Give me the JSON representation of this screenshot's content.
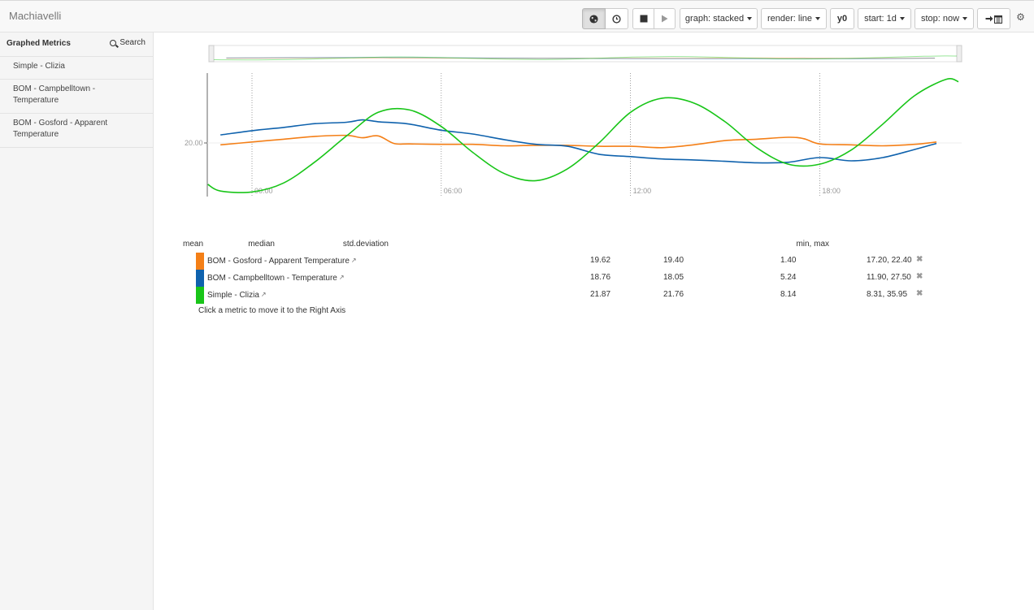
{
  "app": {
    "title": "Machiavelli"
  },
  "toolbar": {
    "live_icon": "globe-icon",
    "clock_icon": "clock-icon",
    "stop_icon": "stop-icon",
    "play_icon": "play-icon",
    "graph_label": "graph: stacked",
    "render_label": "render: line",
    "y0_label": "y0",
    "start_label": "start: 1d",
    "stop_label": "stop: now",
    "export_icon": "arrow-right-icon",
    "calendar_icon": "calendar-icon",
    "settings_icon": "gear-icon"
  },
  "sidebar": {
    "title": "Graphed Metrics",
    "search_label": "Search",
    "items": [
      {
        "label": "Simple - Clizia"
      },
      {
        "label": "BOM - Campbelltown - Temperature"
      },
      {
        "label": "BOM - Gosford - Apparent Temperature"
      }
    ]
  },
  "chart_data": {
    "type": "line",
    "y_tick_label": "20.00",
    "x_tick_labels": [
      "00:00",
      "06:00",
      "12:00",
      "18:00"
    ],
    "grid": "vertical dotted",
    "series": [
      {
        "name": "BOM - Gosford - Apparent Temperature",
        "color": "#f47f17",
        "x_hours": [
          -1.0,
          0,
          1,
          2,
          3,
          3.5,
          4,
          4.5,
          5,
          6,
          7,
          8,
          9,
          10,
          11,
          12,
          13,
          14,
          15,
          16,
          17,
          17.5,
          18,
          19,
          20,
          21,
          21.7
        ],
        "values": [
          19.6,
          20.2,
          20.8,
          21.4,
          21.6,
          21.1,
          21.5,
          19.9,
          19.8,
          19.7,
          19.7,
          19.4,
          19.5,
          19.5,
          19.3,
          19.3,
          19.0,
          19.6,
          20.5,
          20.8,
          21.2,
          20.9,
          19.8,
          19.6,
          19.4,
          19.7,
          20.2
        ]
      },
      {
        "name": "BOM - Campbelltown - Temperature",
        "color": "#0f62ad",
        "x_hours": [
          -1.0,
          0,
          1,
          2,
          3,
          3.5,
          4,
          4.5,
          5,
          6,
          7,
          8,
          9,
          10,
          11,
          12,
          13,
          14,
          15,
          16,
          17,
          18,
          19,
          20,
          21,
          21.7
        ],
        "values": [
          21.7,
          22.6,
          23.3,
          24.1,
          24.4,
          24.9,
          24.5,
          24.3,
          24.0,
          22.7,
          21.9,
          20.7,
          19.7,
          19.3,
          17.6,
          17.1,
          16.6,
          16.4,
          16.1,
          15.8,
          15.9,
          16.9,
          16.2,
          16.9,
          18.6,
          19.9
        ]
      },
      {
        "name": "Simple - Clizia",
        "color": "#18c518",
        "x_hours": [
          -1.4,
          -1,
          0,
          1,
          2,
          3,
          4,
          5,
          6,
          7,
          8,
          9,
          10,
          11,
          12,
          13,
          14,
          15,
          16,
          17,
          18,
          19,
          20,
          21,
          22,
          22.4
        ],
        "values": [
          11.2,
          9.8,
          9.6,
          11.5,
          16.0,
          21.5,
          26.5,
          27.0,
          23.5,
          18.0,
          13.5,
          12.0,
          14.5,
          20.0,
          26.5,
          29.5,
          28.5,
          24.5,
          19.0,
          15.5,
          15.5,
          18.5,
          24.0,
          30.0,
          33.5,
          33.0
        ]
      }
    ]
  },
  "legend": {
    "headers": {
      "mean": "mean",
      "median": "median",
      "std": "std.deviation",
      "minmax": "min, max"
    },
    "rows": [
      {
        "name": "BOM - Gosford - Apparent Temperature",
        "color": "#f47f17",
        "mean": "19.62",
        "median": "19.40",
        "std": "1.40",
        "minmax": "17.20, 22.40"
      },
      {
        "name": "BOM - Campbelltown - Temperature",
        "color": "#0f62ad",
        "mean": "18.76",
        "median": "18.05",
        "std": "5.24",
        "minmax": "11.90, 27.50"
      },
      {
        "name": "Simple - Clizia",
        "color": "#18c518",
        "mean": "21.87",
        "median": "21.76",
        "std": "8.14",
        "minmax": "8.31, 35.95"
      }
    ],
    "hint": "Click a metric to move it to the Right Axis",
    "external_icon": "external-link-icon",
    "remove_icon": "close-icon"
  }
}
